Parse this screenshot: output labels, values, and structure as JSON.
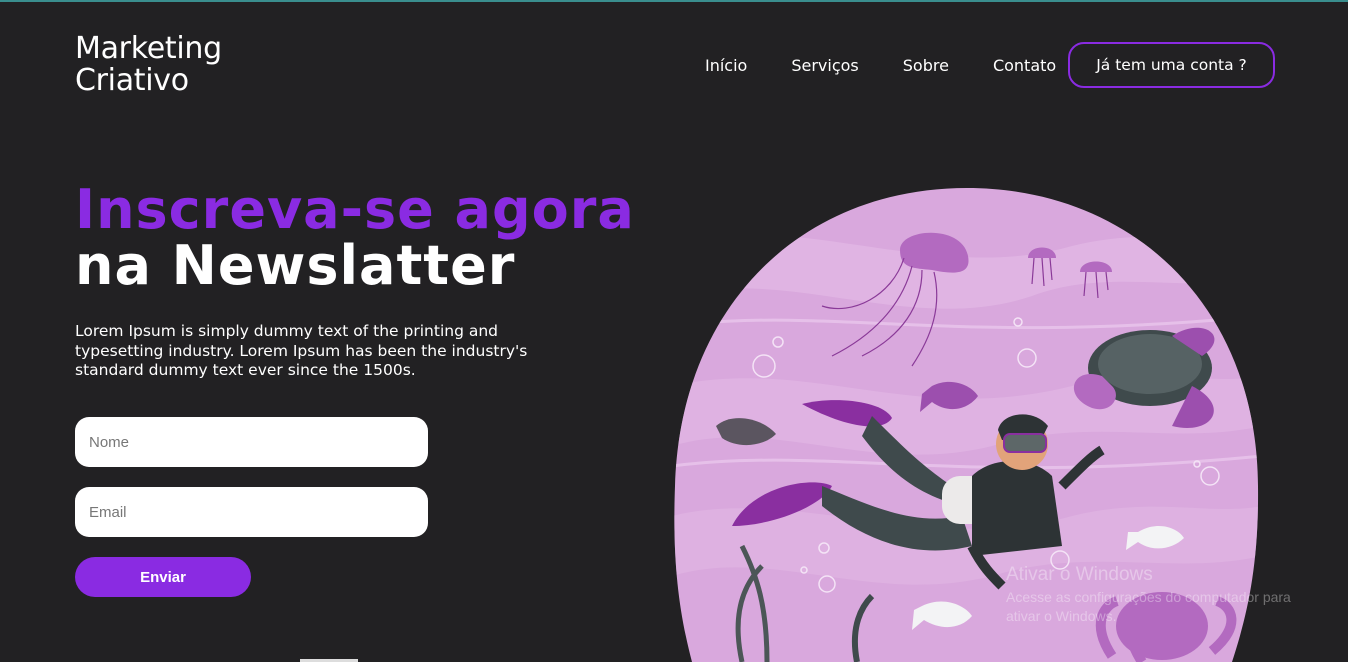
{
  "brand": {
    "line1": "Marketing",
    "line2": "Criativo"
  },
  "nav": {
    "items": [
      "Início",
      "Serviços",
      "Sobre",
      "Contato"
    ],
    "account_button": "Já tem uma conta ?"
  },
  "hero": {
    "title_line1": "Inscreva-se agora",
    "title_line2": "na Newslatter",
    "description": "Lorem Ipsum is simply dummy text of the printing and typesetting industry. Lorem Ipsum has been the industry's standard dummy text ever since the 1500s."
  },
  "form": {
    "name_placeholder": "Nome",
    "email_placeholder": "Email",
    "submit_label": "Enviar"
  },
  "watermark": {
    "title": "Ativar o Windows",
    "subtitle": "Acesse as configurações do computador para ativar o Windows."
  },
  "colors": {
    "accent": "#8a2be2",
    "background": "#222123",
    "illustration_bg": "#d9a8dd"
  }
}
